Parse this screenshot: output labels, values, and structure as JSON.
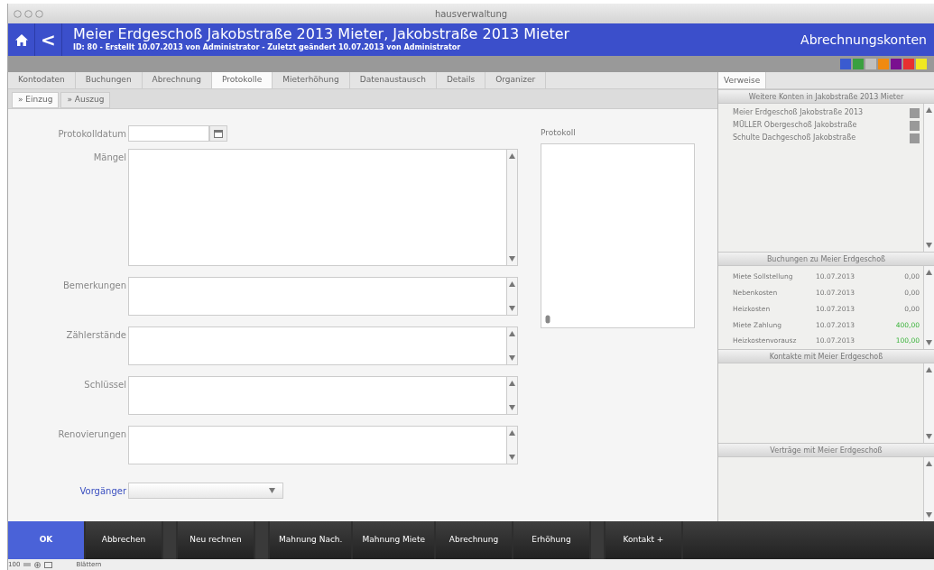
{
  "window": {
    "title": "hausverwaltung"
  },
  "header": {
    "back_label": "<",
    "title": "Meier Erdgeschoß Jakobstraße 2013 Mieter, Jakobstraße 2013 Mieter",
    "subtitle": "ID: 80 - Erstellt 10.07.2013 von Administrator - Zuletzt geändert 10.07.2013 von Administrator",
    "section": "Abrechnungskonten",
    "swatches": [
      {
        "color": "#3a5bd0"
      },
      {
        "color": "#3aa040"
      },
      {
        "color": "#c0c0c0"
      },
      {
        "color": "#f08a10"
      },
      {
        "color": "#7a1090"
      },
      {
        "color": "#e83030"
      },
      {
        "color": "#f0e820"
      }
    ]
  },
  "tabs": [
    {
      "label": "Kontodaten",
      "selected": false
    },
    {
      "label": "Buchungen",
      "selected": false
    },
    {
      "label": "Abrechnung",
      "selected": false
    },
    {
      "label": "Protokolle",
      "selected": true
    },
    {
      "label": "Mieterhöhung",
      "selected": false
    },
    {
      "label": "Datenaustausch",
      "selected": false
    },
    {
      "label": "Details",
      "selected": false
    },
    {
      "label": "Organizer",
      "selected": false
    }
  ],
  "subtabs": [
    {
      "label": "» Einzug",
      "selected": true
    },
    {
      "label": "» Auszug",
      "selected": false
    }
  ],
  "form": {
    "fields": [
      {
        "label": "Protokolldatum",
        "kind": "date"
      },
      {
        "label": "Mängel",
        "kind": "large-textarea"
      },
      {
        "label": "Bemerkungen",
        "kind": "textarea"
      },
      {
        "label": "Zählerstände",
        "kind": "textarea"
      },
      {
        "label": "Schlüssel",
        "kind": "textarea"
      },
      {
        "label": "Renovierungen",
        "kind": "textarea"
      },
      {
        "label": "Vorgänger",
        "kind": "select"
      }
    ],
    "protokoll_label": "Protokoll"
  },
  "sidebar": {
    "tab": "Verweise",
    "accounts": {
      "title": "Weitere Konten in Jakobstraße 2013 Mieter",
      "items": [
        "Meier Erdgeschoß Jakobstraße 2013",
        "MÜLLER Obergeschoß Jakobstraße",
        "Schulte Dachgeschoß Jakobstraße"
      ]
    },
    "bookings": {
      "title": "Buchungen zu Meier Erdgeschoß",
      "rows": [
        {
          "name": "Miete Sollstellung",
          "date": "10.07.2013",
          "amount": "0,00",
          "paid": false
        },
        {
          "name": "Nebenkosten",
          "date": "10.07.2013",
          "amount": "0,00",
          "paid": false
        },
        {
          "name": "Heizkosten",
          "date": "10.07.2013",
          "amount": "0,00",
          "paid": false
        },
        {
          "name": "Miete Zahlung",
          "date": "10.07.2013",
          "amount": "400,00",
          "paid": true
        },
        {
          "name": "Heizkostenvorausz",
          "date": "10.07.2013",
          "amount": "100,00",
          "paid": true
        }
      ]
    },
    "contacts": {
      "title": "Kontakte mit Meier Erdgeschoß"
    },
    "contracts": {
      "title": "Verträge mit Meier Erdgeschoß"
    }
  },
  "buttons": [
    {
      "label": "OK",
      "kind": "primary"
    },
    {
      "label": "Abbrechen",
      "kind": "normal"
    },
    {
      "label": "Neu rechnen",
      "kind": "normal"
    },
    {
      "label": "Mahnung Nach.",
      "kind": "normal"
    },
    {
      "label": "Mahnung Miete",
      "kind": "normal"
    },
    {
      "label": "Abrechnung",
      "kind": "normal"
    },
    {
      "label": "Erhöhung",
      "kind": "normal"
    },
    {
      "label": "Kontakt +",
      "kind": "normal"
    }
  ],
  "status_bar": {
    "zoom": "100",
    "mode": "Blättern"
  }
}
